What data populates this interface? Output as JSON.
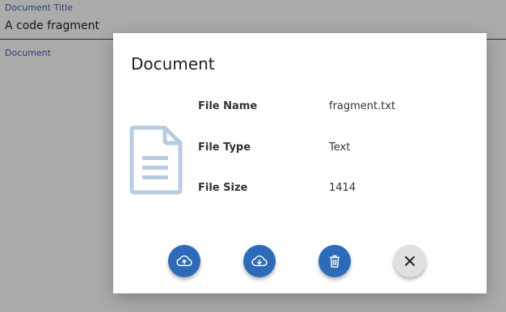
{
  "form": {
    "title_label": "Document Title",
    "title_value": "A code fragment",
    "document_label": "Document"
  },
  "dialog": {
    "title": "Document",
    "rows": [
      {
        "label": "File Name",
        "value": "fragment.txt"
      },
      {
        "label": "File Type",
        "value": "Text"
      },
      {
        "label": "File Size",
        "value": "1414"
      }
    ],
    "icons": {
      "document": "document-icon",
      "upload": "cloud-upload-icon",
      "download": "cloud-download-icon",
      "delete": "trash-icon",
      "close": "close-icon"
    }
  },
  "colors": {
    "accent": "#2d6bb8",
    "label": "#3b5ea8",
    "doc_icon": "#b9cbe2"
  }
}
